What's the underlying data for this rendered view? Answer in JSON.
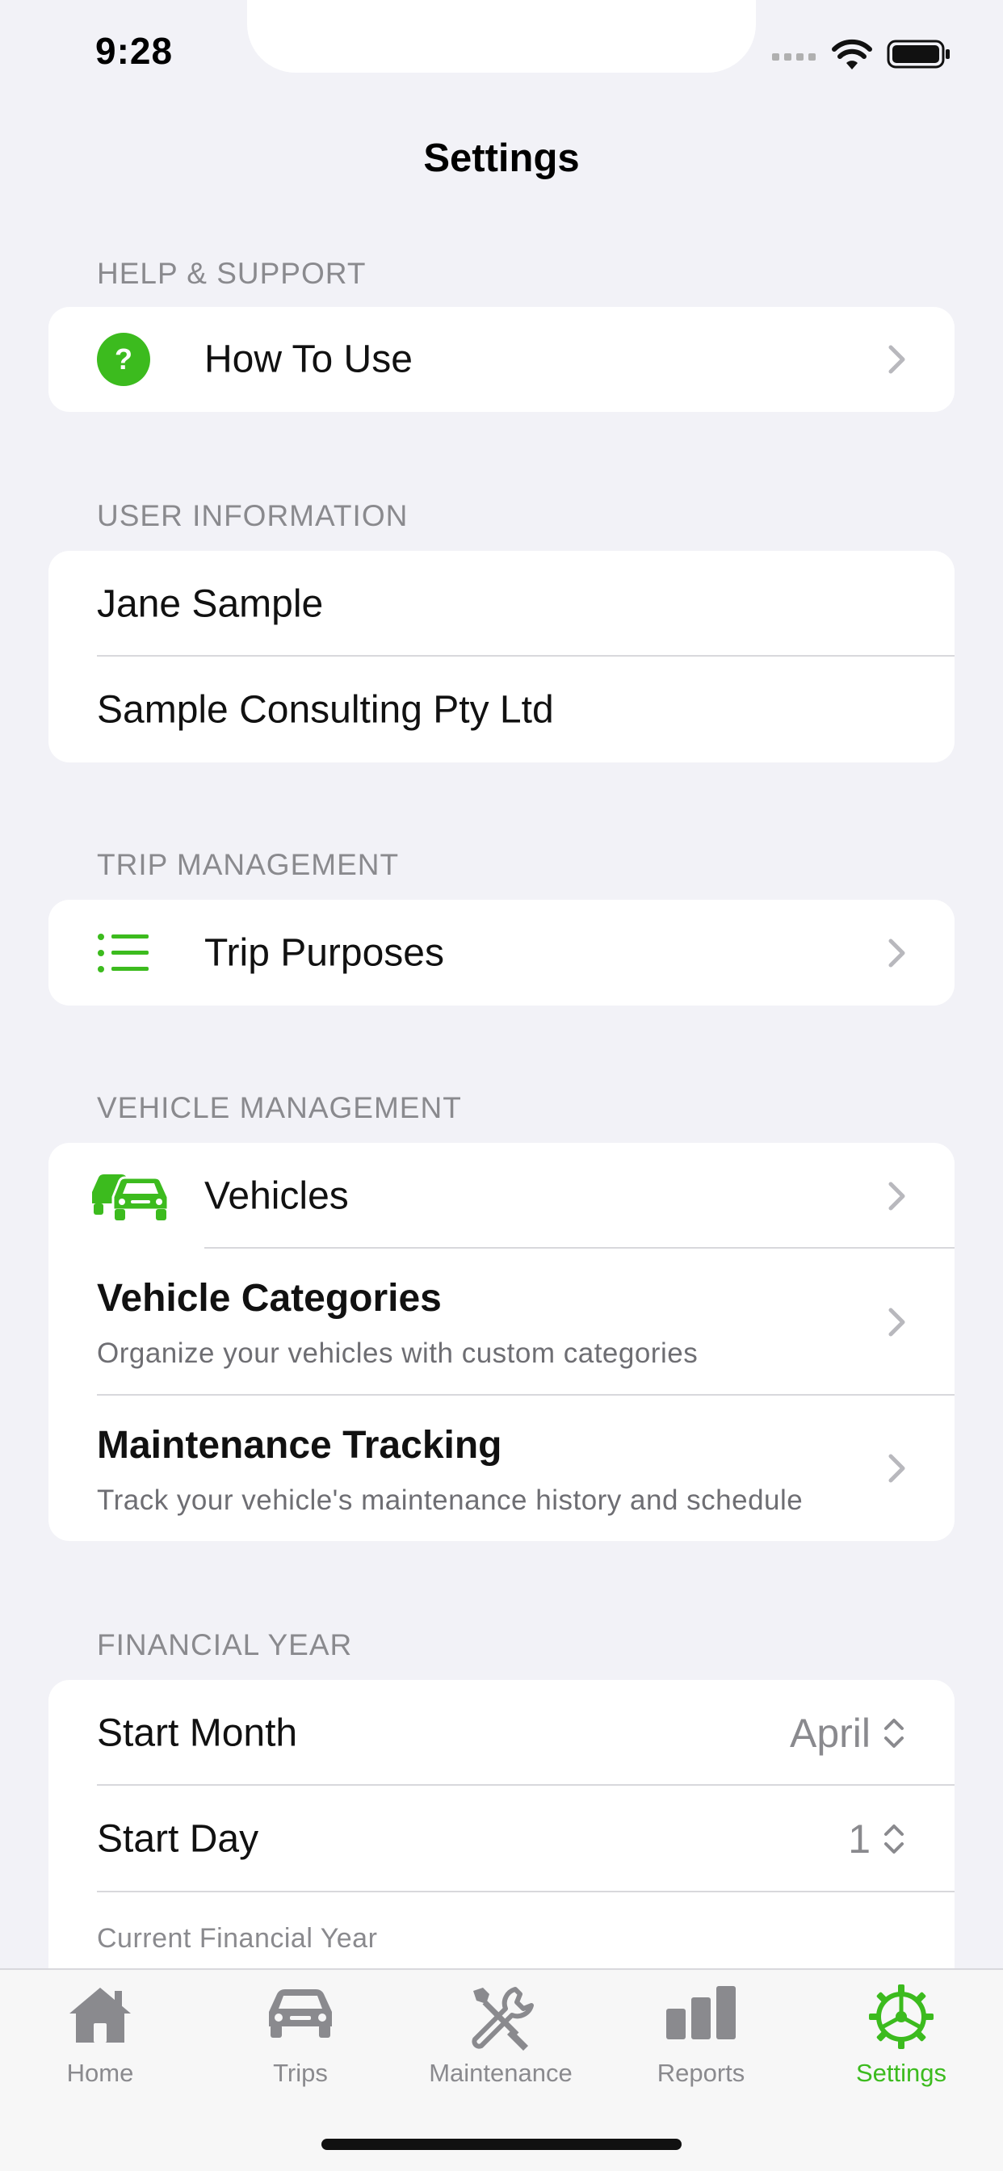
{
  "status_bar": {
    "time": "9:28"
  },
  "nav": {
    "title": "Settings"
  },
  "sections": {
    "help": {
      "header": "HELP & SUPPORT",
      "how_to_use": "How To Use"
    },
    "user": {
      "header": "USER INFORMATION",
      "name": "Jane Sample",
      "company": "Sample Consulting Pty Ltd"
    },
    "trip": {
      "header": "TRIP MANAGEMENT",
      "trip_purposes": "Trip Purposes"
    },
    "vehicle": {
      "header": "VEHICLE MANAGEMENT",
      "vehicles": "Vehicles",
      "categories_title": "Vehicle Categories",
      "categories_sub": "Organize your vehicles with custom categories",
      "maintenance_title": "Maintenance Tracking",
      "maintenance_sub": "Track your vehicle's maintenance history and schedule"
    },
    "financial": {
      "header": "FINANCIAL YEAR",
      "start_month_label": "Start Month",
      "start_month_value": "April",
      "start_day_label": "Start Day",
      "start_day_value": "1",
      "current_fy_label": "Current Financial Year"
    }
  },
  "tabs": [
    {
      "label": "Home",
      "icon": "house-icon"
    },
    {
      "label": "Trips",
      "icon": "car-icon"
    },
    {
      "label": "Maintenance",
      "icon": "tools-icon"
    },
    {
      "label": "Reports",
      "icon": "bar-chart-icon"
    },
    {
      "label": "Settings",
      "icon": "gear-icon",
      "active": true
    }
  ],
  "colors": {
    "accent": "#3CBB1E",
    "background": "#F2F2F7",
    "secondary_text": "#8A8A8E"
  }
}
